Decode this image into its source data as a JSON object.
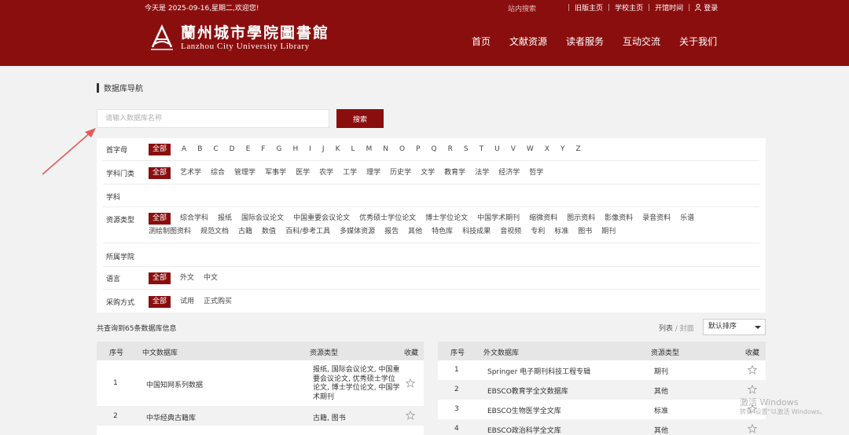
{
  "header": {
    "greeting": "今天是 2025-09-16,星期二,欢迎您!",
    "site_search": "站内搜索",
    "links": [
      "旧版主页",
      "学校主页",
      "开馆时间"
    ],
    "login": "登录",
    "logo_cn": "蘭州城市學院圖書館",
    "logo_en": "Lanzhou City University Library",
    "nav": [
      "首页",
      "文献资源",
      "读者服务",
      "互动交流",
      "关于我们"
    ],
    "brand_color": "#8b0e0e"
  },
  "page": {
    "section_title": "数据库导航",
    "search_placeholder": "请输入数据库名称",
    "search_button": "搜索"
  },
  "filters": {
    "letter": {
      "label": "首字母",
      "options": [
        "全部",
        "A",
        "B",
        "C",
        "D",
        "E",
        "F",
        "G",
        "H",
        "I",
        "J",
        "K",
        "L",
        "M",
        "N",
        "O",
        "P",
        "Q",
        "R",
        "S",
        "T",
        "U",
        "V",
        "W",
        "X",
        "Y",
        "Z"
      ]
    },
    "discipline": {
      "label": "学科门类",
      "options": [
        "全部",
        "艺术学",
        "综合",
        "管理学",
        "军事学",
        "医学",
        "农学",
        "工学",
        "理学",
        "历史学",
        "文学",
        "教育学",
        "法学",
        "经济学",
        "哲学"
      ]
    },
    "subject": {
      "label": "学科"
    },
    "resource_type": {
      "label": "资源类型",
      "options": [
        "全部",
        "综合学科",
        "报纸",
        "国际会议论文",
        "中国重要会议论文",
        "优秀硕士学位论文",
        "博士学位论文",
        "中国学术期刊",
        "缩微资料",
        "图示资料",
        "影像资料",
        "录音资料",
        "乐谱",
        "测绘制图资料",
        "规范文档",
        "古籍",
        "数值",
        "百科/参考工具",
        "多媒体资源",
        "报告",
        "其他",
        "特色库",
        "科技成果",
        "音视频",
        "专利",
        "标准",
        "图书",
        "期刊"
      ]
    },
    "college": {
      "label": "所属学院"
    },
    "language": {
      "label": "语言",
      "options": [
        "全部",
        "外文",
        "中文"
      ]
    },
    "purchase": {
      "label": "采购方式",
      "options": [
        "全部",
        "试用",
        "正式购买"
      ]
    }
  },
  "results": {
    "count_text": "共查询到65条数据库信息",
    "view_list": "列表",
    "view_sep": " / ",
    "view_cover": "封面",
    "sort_value": "默认排序"
  },
  "table_cn": {
    "headers": [
      "序号",
      "中文数据库",
      "资源类型",
      "收藏"
    ],
    "rows": [
      {
        "no": "1",
        "name": "中国知网系列数据",
        "type": "报纸, 国际会议论文, 中国重要会议论文, 优秀硕士学位论文, 博士学位论文, 中国学术期刊"
      },
      {
        "no": "2",
        "name": "中华经典古籍库",
        "type": "古籍, 图书"
      }
    ]
  },
  "table_en": {
    "headers": [
      "序号",
      "外文数据库",
      "资源类型",
      "收藏"
    ],
    "rows": [
      {
        "no": "1",
        "name": "Springer 电子期刊科技工程专辑",
        "type": "期刊"
      },
      {
        "no": "2",
        "name": "EBSCO教育学全文数据库",
        "type": "其他"
      },
      {
        "no": "3",
        "name": "EBSCO生物医学全文库",
        "type": "标准"
      },
      {
        "no": "4",
        "name": "EBSCO政治科学全文库",
        "type": "其他"
      }
    ]
  },
  "watermark": {
    "line1": "激活 Windows",
    "line2": "转到\"设置\"以激活 Windows。"
  }
}
